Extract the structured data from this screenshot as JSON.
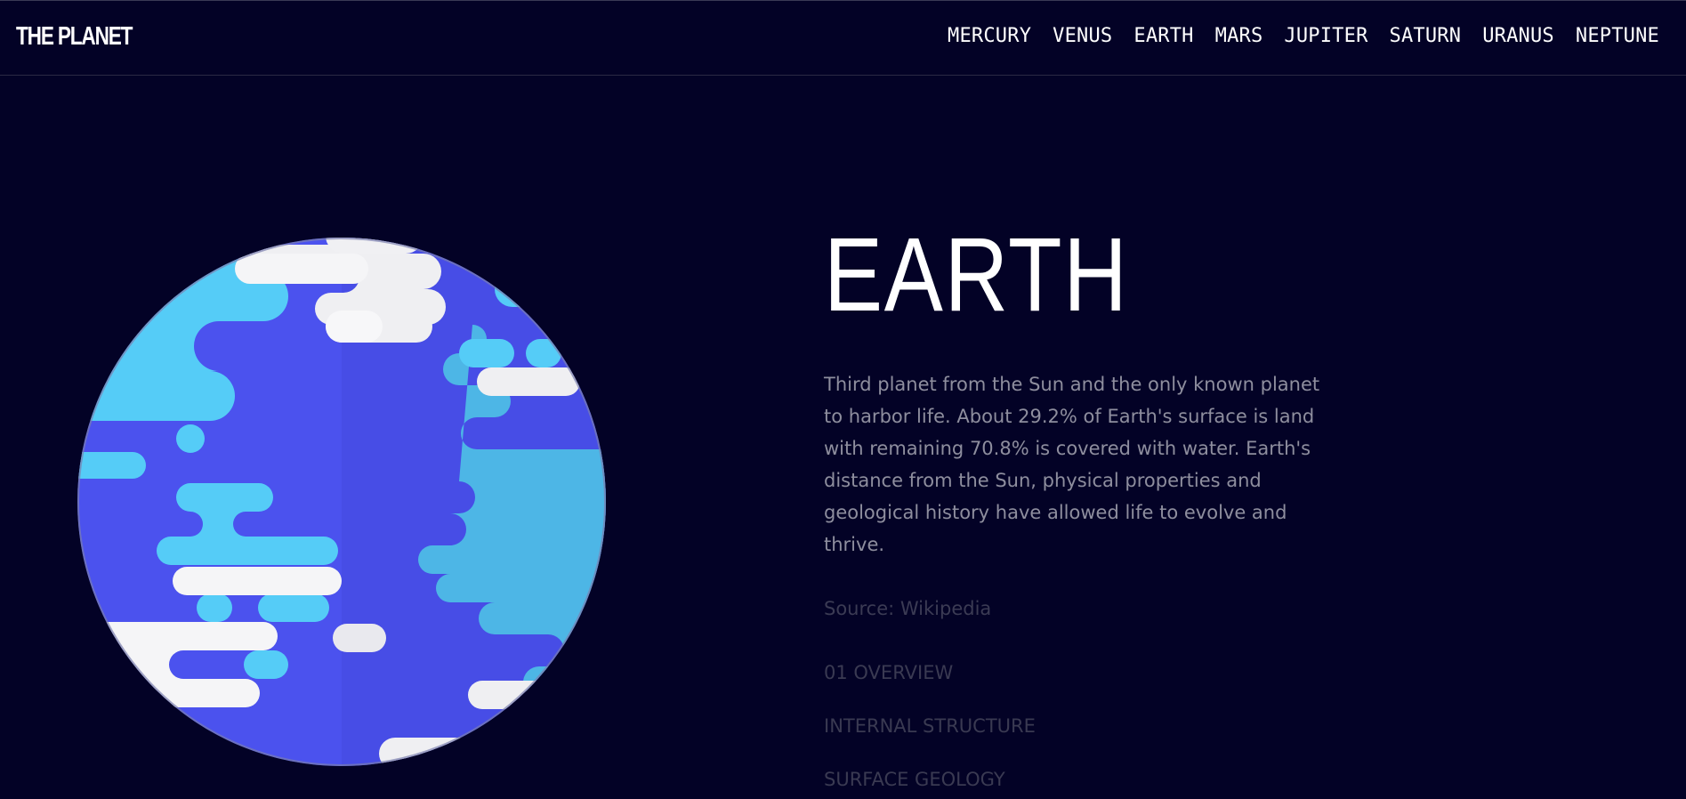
{
  "header": {
    "brand": "THE PLANET",
    "nav": [
      "MERCURY",
      "VENUS",
      "EARTH",
      "MARS",
      "JUPITER",
      "SATURN",
      "URANUS",
      "NEPTUNE"
    ]
  },
  "planet": {
    "image_icon": "earth-illustration",
    "name": "EARTH",
    "description": "Third planet from the Sun and the only known planet to harbor life. About 29.2% of Earth's surface is land with remaining 70.8% is covered with water. Earth's distance from the Sun, physical properties and geological history have allowed life to evolve and thrive.",
    "source": "Source: Wikipedia",
    "tabs": [
      "01 OVERVIEW",
      "INTERNAL STRUCTURE",
      "SURFACE GEOLOGY"
    ]
  },
  "colors": {
    "background": "#030226",
    "ocean": "#4B52EE",
    "land": "#55CCF7",
    "cloud": "#F2F2F4",
    "text_muted": "#8E8E9E"
  }
}
